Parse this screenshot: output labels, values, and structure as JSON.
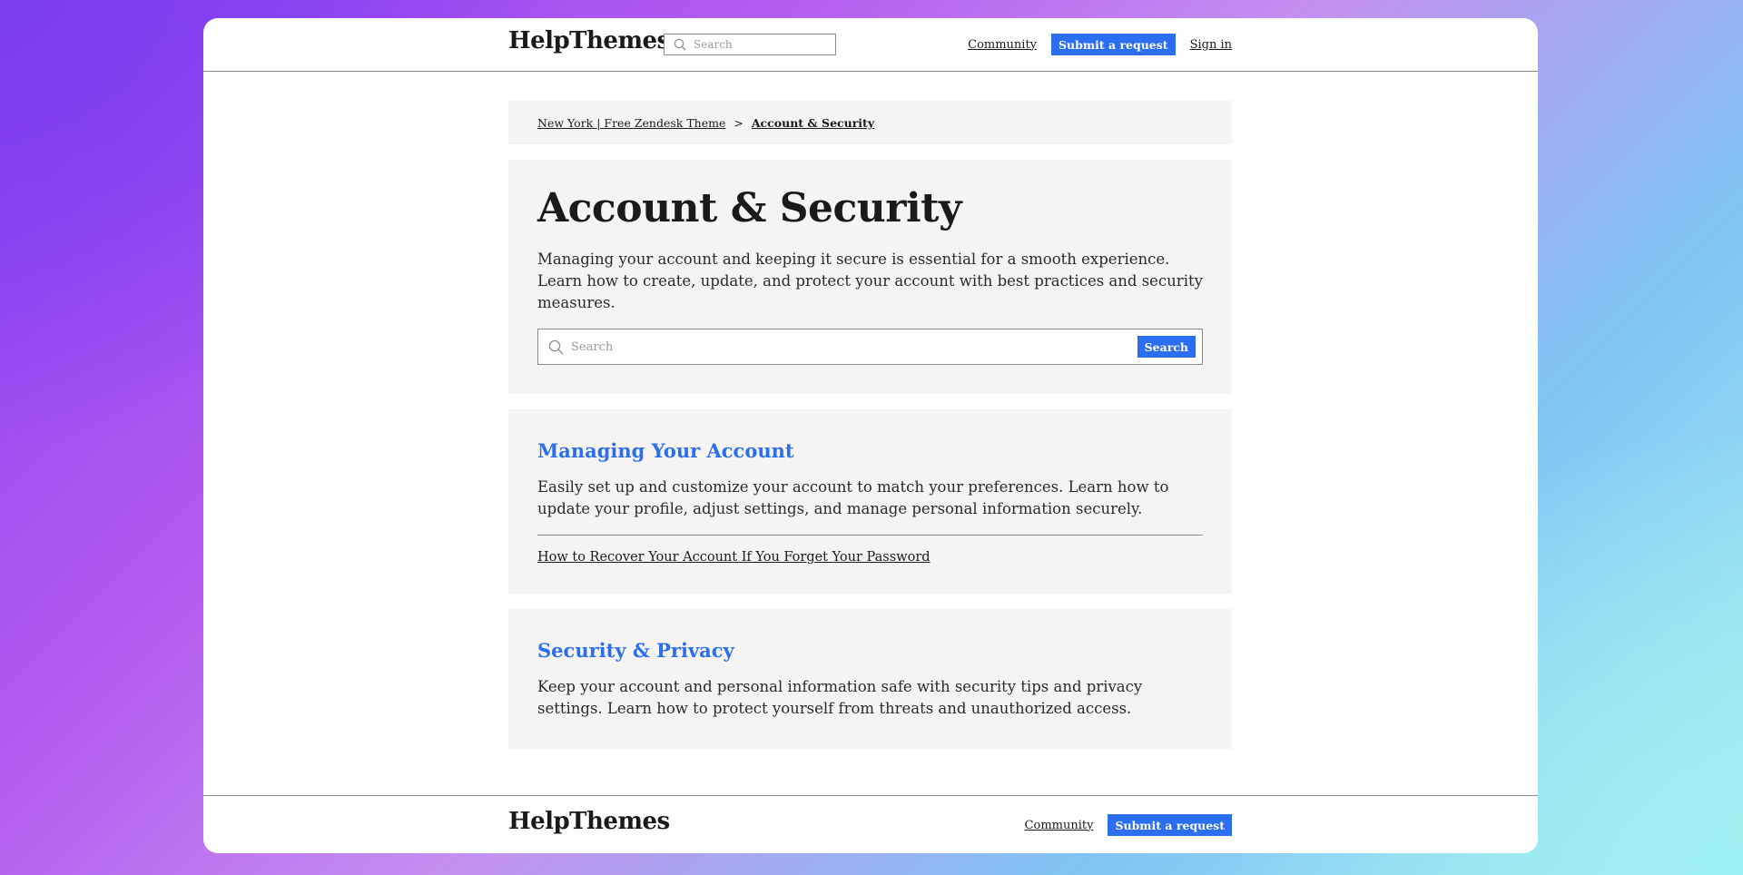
{
  "header": {
    "logo": "HelpThemes",
    "search_placeholder": "Search",
    "community_label": "Community",
    "submit_label": "Submit a request",
    "signin_label": "Sign in"
  },
  "breadcrumb": {
    "home": "New York | Free Zendesk Theme",
    "separator": ">",
    "current": "Account & Security"
  },
  "hero": {
    "title": "Account & Security",
    "description": "Managing your account and keeping it secure is essential for a smooth experience. Learn how to create, update, and protect your account with best practices and security measures.",
    "search_placeholder": "Search",
    "search_button": "Search"
  },
  "sections": [
    {
      "title": "Managing Your Account",
      "description": "Easily set up and customize your account to match your preferences. Learn how to update your profile, adjust settings, and manage personal information securely.",
      "articles": [
        "How to Recover Your Account If You Forget Your Password"
      ]
    },
    {
      "title": "Security & Privacy",
      "description": "Keep your account and personal information safe with security tips and privacy settings. Learn how to protect yourself from threats and unauthorized access."
    }
  ],
  "footer": {
    "logo": "HelpThemes",
    "community_label": "Community",
    "submit_label": "Submit a request"
  },
  "colors": {
    "accent": "#2b6ef0",
    "panel": "#f5f4f2"
  }
}
